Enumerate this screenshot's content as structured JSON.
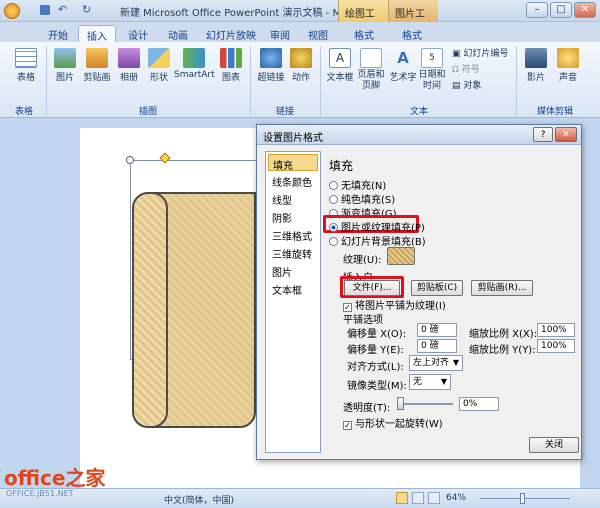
{
  "window": {
    "title": "新建 Microsoft Office PowerPoint 演示文稿 - M...",
    "ctx_tab_1": "绘图工具",
    "ctx_tab_2": "图片工具",
    "min": "–",
    "max": "□",
    "close": "✕"
  },
  "tabs": [
    "开始",
    "插入",
    "设计",
    "动画",
    "幻灯片放映",
    "审阅",
    "视图",
    "格式",
    "格式"
  ],
  "ribbon": {
    "table": "表格",
    "picture": "图片",
    "clipart": "剪贴画",
    "album": "相册",
    "shapes": "形状",
    "smartart": "SmartArt",
    "chart": "图表",
    "hyperlink": "超链接",
    "action": "动作",
    "textbox": "文本框",
    "header": "页眉和页脚",
    "wordart": "艺术字",
    "datetime": "日期和时间",
    "slide_number": "幻灯片编号",
    "symbol": "符号",
    "object": "对象",
    "movie": "影片",
    "sound": "声音",
    "groups": {
      "tables": "表格",
      "illustrations": "插图",
      "links": "链接",
      "text": "文本",
      "media": "媒体剪辑"
    }
  },
  "dialog": {
    "title": "设置图片格式",
    "help": "?",
    "close": "✕",
    "nav": [
      "填充",
      "线条颜色",
      "线型",
      "阴影",
      "三维格式",
      "三维旋转",
      "图片",
      "文本框"
    ],
    "section": "填充",
    "fill_options": [
      "无填充(N)",
      "纯色填充(S)",
      "渐变填充(G)",
      "图片或纹理填充(P)",
      "幻灯片背景填充(B)"
    ],
    "texture_label": "纹理(U):",
    "insert_from": "插入自:",
    "file_btn": "文件(F)...",
    "clipboard_btn": "剪贴板(C)",
    "clipart_btn": "剪贴画(R)...",
    "tile_checkbox": "将图片平铺为纹理(I)",
    "tile_options": "平铺选项",
    "offset_x": "偏移量 X(O):",
    "offset_x_val": "0 磅",
    "offset_y": "偏移量 Y(E):",
    "offset_y_val": "0 磅",
    "scale_x": "缩放比例 X(X):",
    "scale_x_val": "100%",
    "scale_y": "缩放比例 Y(Y):",
    "scale_y_val": "100%",
    "align": "对齐方式(L):",
    "align_val": "左上对齐",
    "mirror": "镜像类型(M):",
    "mirror_val": "无",
    "transparency": "透明度(T):",
    "transparency_val": "0%",
    "transparency_level": 0,
    "rotate_checkbox": "与形状一起旋转(W)",
    "close_btn": "关闭"
  },
  "statusbar": {
    "language": "中文(简体，中国)",
    "zoom": "64%",
    "logo_main": "office之家",
    "logo_sub": "OFFICE.JB51.NET"
  }
}
